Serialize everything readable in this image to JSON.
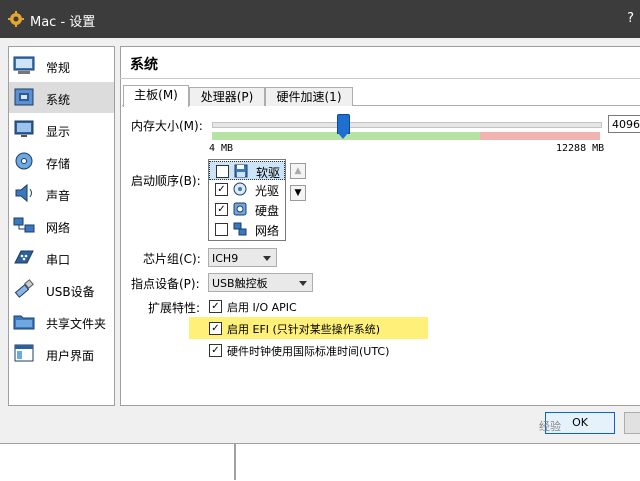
{
  "window": {
    "title": "Mac - 设置",
    "help": "?"
  },
  "sidebar": {
    "items": [
      {
        "label": "常规",
        "icon": "general-icon"
      },
      {
        "label": "系统",
        "icon": "system-icon",
        "selected": true
      },
      {
        "label": "显示",
        "icon": "display-icon"
      },
      {
        "label": "存储",
        "icon": "storage-icon"
      },
      {
        "label": "声音",
        "icon": "audio-icon"
      },
      {
        "label": "网络",
        "icon": "network-icon"
      },
      {
        "label": "串口",
        "icon": "serial-port-icon"
      },
      {
        "label": "USB设备",
        "icon": "usb-icon"
      },
      {
        "label": "共享文件夹",
        "icon": "shared-folder-icon"
      },
      {
        "label": "用户界面",
        "icon": "user-interface-icon"
      }
    ]
  },
  "page": {
    "title": "系统"
  },
  "tabs": [
    {
      "label": "主板(M)",
      "active": true
    },
    {
      "label": "处理器(P)"
    },
    {
      "label": "硬件加速(1)"
    }
  ],
  "motherboard": {
    "memory_label": "内存大小(M):",
    "memory_value": "4096",
    "memory_min": "4 MB",
    "memory_max": "12288 MB",
    "boot_label": "启动顺序(B):",
    "boot_items": [
      {
        "label": "软驱",
        "checked": false,
        "icon": "floppy-icon"
      },
      {
        "label": "光驱",
        "checked": true,
        "icon": "optical-drive-icon"
      },
      {
        "label": "硬盘",
        "checked": true,
        "icon": "hard-disk-icon"
      },
      {
        "label": "网络",
        "checked": false,
        "icon": "network-boot-icon"
      }
    ],
    "chipset_label": "芯片组(C):",
    "chipset_value": "ICH9",
    "pointing_label": "指点设备(P):",
    "pointing_value": "USB触控板",
    "features_label": "扩展特性:",
    "features": [
      {
        "label": "启用 I/O APIC",
        "checked": true
      },
      {
        "label": "启用 EFI (只针对某些操作系统)",
        "checked": true,
        "highlight_color": "#fff07a"
      },
      {
        "label": "硬件时钟使用国际标准时间(UTC)",
        "checked": true
      }
    ]
  },
  "buttons": {
    "ok": "OK"
  },
  "watermark": "经验"
}
